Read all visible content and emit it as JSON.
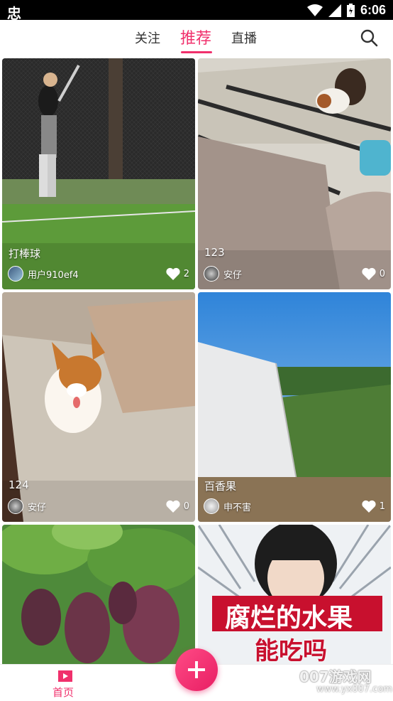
{
  "status_bar": {
    "logo": "忠",
    "time": "6:06"
  },
  "top_nav": {
    "tabs": [
      {
        "label": "关注",
        "active": false
      },
      {
        "label": "推荐",
        "active": true
      },
      {
        "label": "直播",
        "active": false
      }
    ],
    "accent_color": "#f0306c"
  },
  "feed": {
    "items": [
      {
        "title": "打棒球",
        "author": "用户910ef4",
        "likes": "2",
        "thumbnail": "baseball-batting-cage"
      },
      {
        "title": "123",
        "author": "安仔",
        "likes": "0",
        "thumbnail": "puppy-living-room-floor"
      },
      {
        "title": "124",
        "author": "安仔",
        "likes": "0",
        "thumbnail": "corgi-puppy-sofa"
      },
      {
        "title": "百香果",
        "author": "申不害",
        "likes": "1",
        "thumbnail": "greenhouse-field"
      },
      {
        "title": "",
        "author": "",
        "likes": "",
        "thumbnail": "grape-vines"
      },
      {
        "title": "",
        "author": "",
        "likes": "",
        "thumbnail": "girl-rotten-fruit",
        "overlay_line1": "腐烂的水果",
        "overlay_line2": "能吃吗"
      }
    ]
  },
  "bottom_bar": {
    "home_label": "首页"
  },
  "watermark": {
    "text": "007游戏网",
    "url": "www.yx007.com"
  }
}
